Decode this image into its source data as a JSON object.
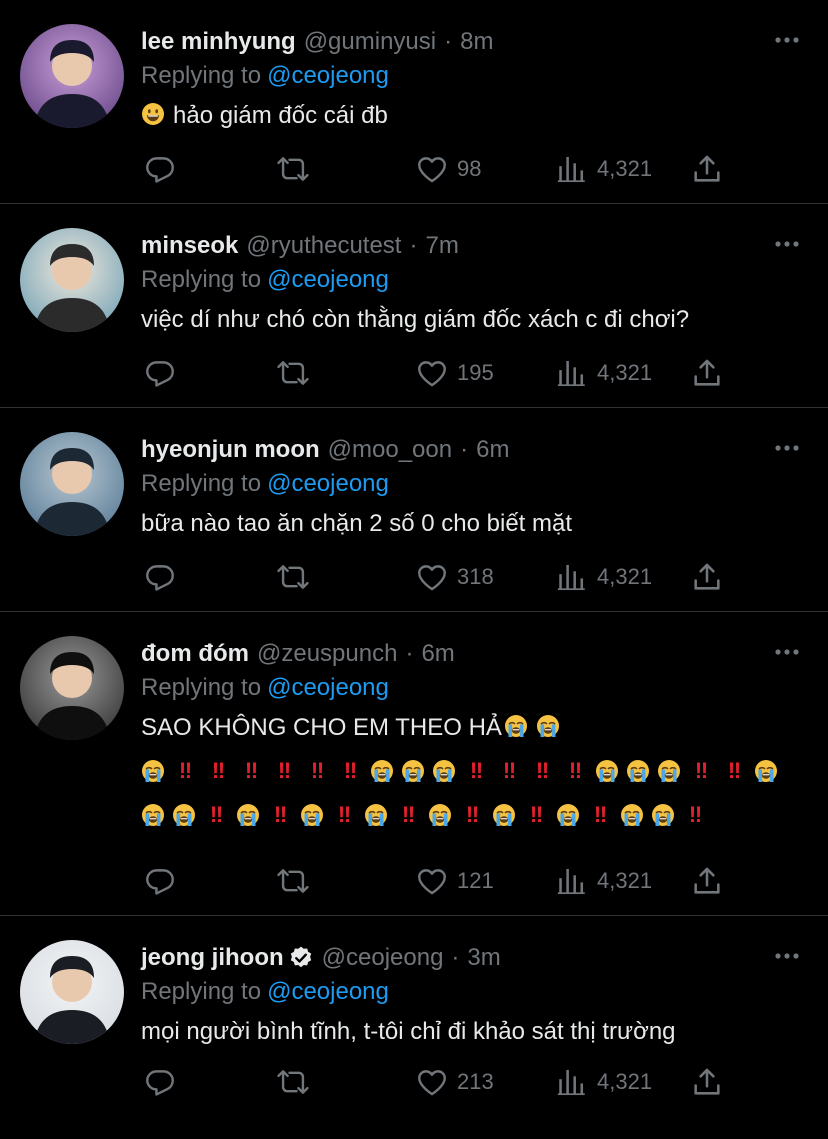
{
  "tweets": [
    {
      "name": "lee minhyung",
      "handle": "@guminyusi",
      "time": "8m",
      "replying_label": "Replying to",
      "replying_to": "@ceojeong",
      "verified": false,
      "text_lines": [
        "hảo giám đốc cái đb"
      ],
      "likes": "98",
      "views": "4,321",
      "avatar_colors": [
        "#6b4a8a",
        "#c9a0d9",
        "#1a1a2e"
      ]
    },
    {
      "name": "minseok",
      "handle": "@ryuthecutest",
      "time": "7m",
      "replying_label": "Replying to",
      "replying_to": "@ceojeong",
      "verified": false,
      "text_lines": [
        "việc dí như chó còn thằng giám đốc xách c đi chơi?"
      ],
      "likes": "195",
      "views": "4,321",
      "avatar_colors": [
        "#7aa6b8",
        "#f0e8dc",
        "#2b2b2b"
      ]
    },
    {
      "name": "hyeonjun moon",
      "handle": "@moo_oon",
      "time": "6m",
      "replying_label": "Replying to",
      "replying_to": "@ceojeong",
      "verified": false,
      "text_lines": [
        "bữa nào tao ăn chặn 2 số 0 cho biết mặt"
      ],
      "likes": "318",
      "views": "4,321",
      "avatar_colors": [
        "#5d7f99",
        "#b9c8d2",
        "#1c2833"
      ]
    },
    {
      "name": "đom đóm",
      "handle": "@zeuspunch",
      "time": "6m",
      "replying_label": "Replying to",
      "replying_to": "@ceojeong",
      "verified": false,
      "text_lines": [
        "SAO KHÔNG CHO EM THEO HẢ"
      ],
      "emoji_rows": [
        [
          "cry",
          "bang",
          "bang",
          "bang",
          "bang",
          "bang",
          "bang",
          "cry",
          "cry",
          "cry",
          "bang",
          "bang",
          "bang",
          "bang",
          "cry",
          "cry",
          "cry",
          "bang",
          "bang",
          "cry"
        ],
        [
          "cry",
          "cry",
          "bang",
          "cry",
          "bang",
          "cry",
          "bang",
          "cry",
          "bang",
          "cry",
          "bang",
          "cry",
          "bang",
          "cry",
          "bang",
          "cry",
          "cry",
          "bang"
        ]
      ],
      "likes": "121",
      "views": "4,321",
      "avatar_colors": [
        "#3a3a3a",
        "#9a9a9a",
        "#0f0f0f"
      ]
    },
    {
      "name": "jeong jihoon",
      "handle": "@ceojeong",
      "time": "3m",
      "replying_label": "Replying to",
      "replying_to": "@ceojeong",
      "verified": true,
      "text_lines": [
        "mọi người bình tĩnh, t-tôi chỉ đi khảo sát thị trường"
      ],
      "likes": "213",
      "views": "4,321",
      "avatar_colors": [
        "#d8dde2",
        "#f3f4f6",
        "#1a1d24"
      ]
    }
  ],
  "icons": {
    "more": "more-horizontal-icon",
    "reply": "reply-icon",
    "retweet": "retweet-icon",
    "like": "heart-icon",
    "views": "analytics-icon",
    "share": "share-icon",
    "verified": "verified-badge-icon",
    "smile_emoji": "grinning-face-emoji",
    "cry_emoji": "loudly-crying-face-emoji",
    "bang_emoji": "double-exclamation-emoji"
  },
  "colors": {
    "background": "#000000",
    "text": "#e7e9ea",
    "muted": "#71767b",
    "accent": "#1d9bf0",
    "divider": "#2f3336",
    "bang": "#e0212b"
  }
}
